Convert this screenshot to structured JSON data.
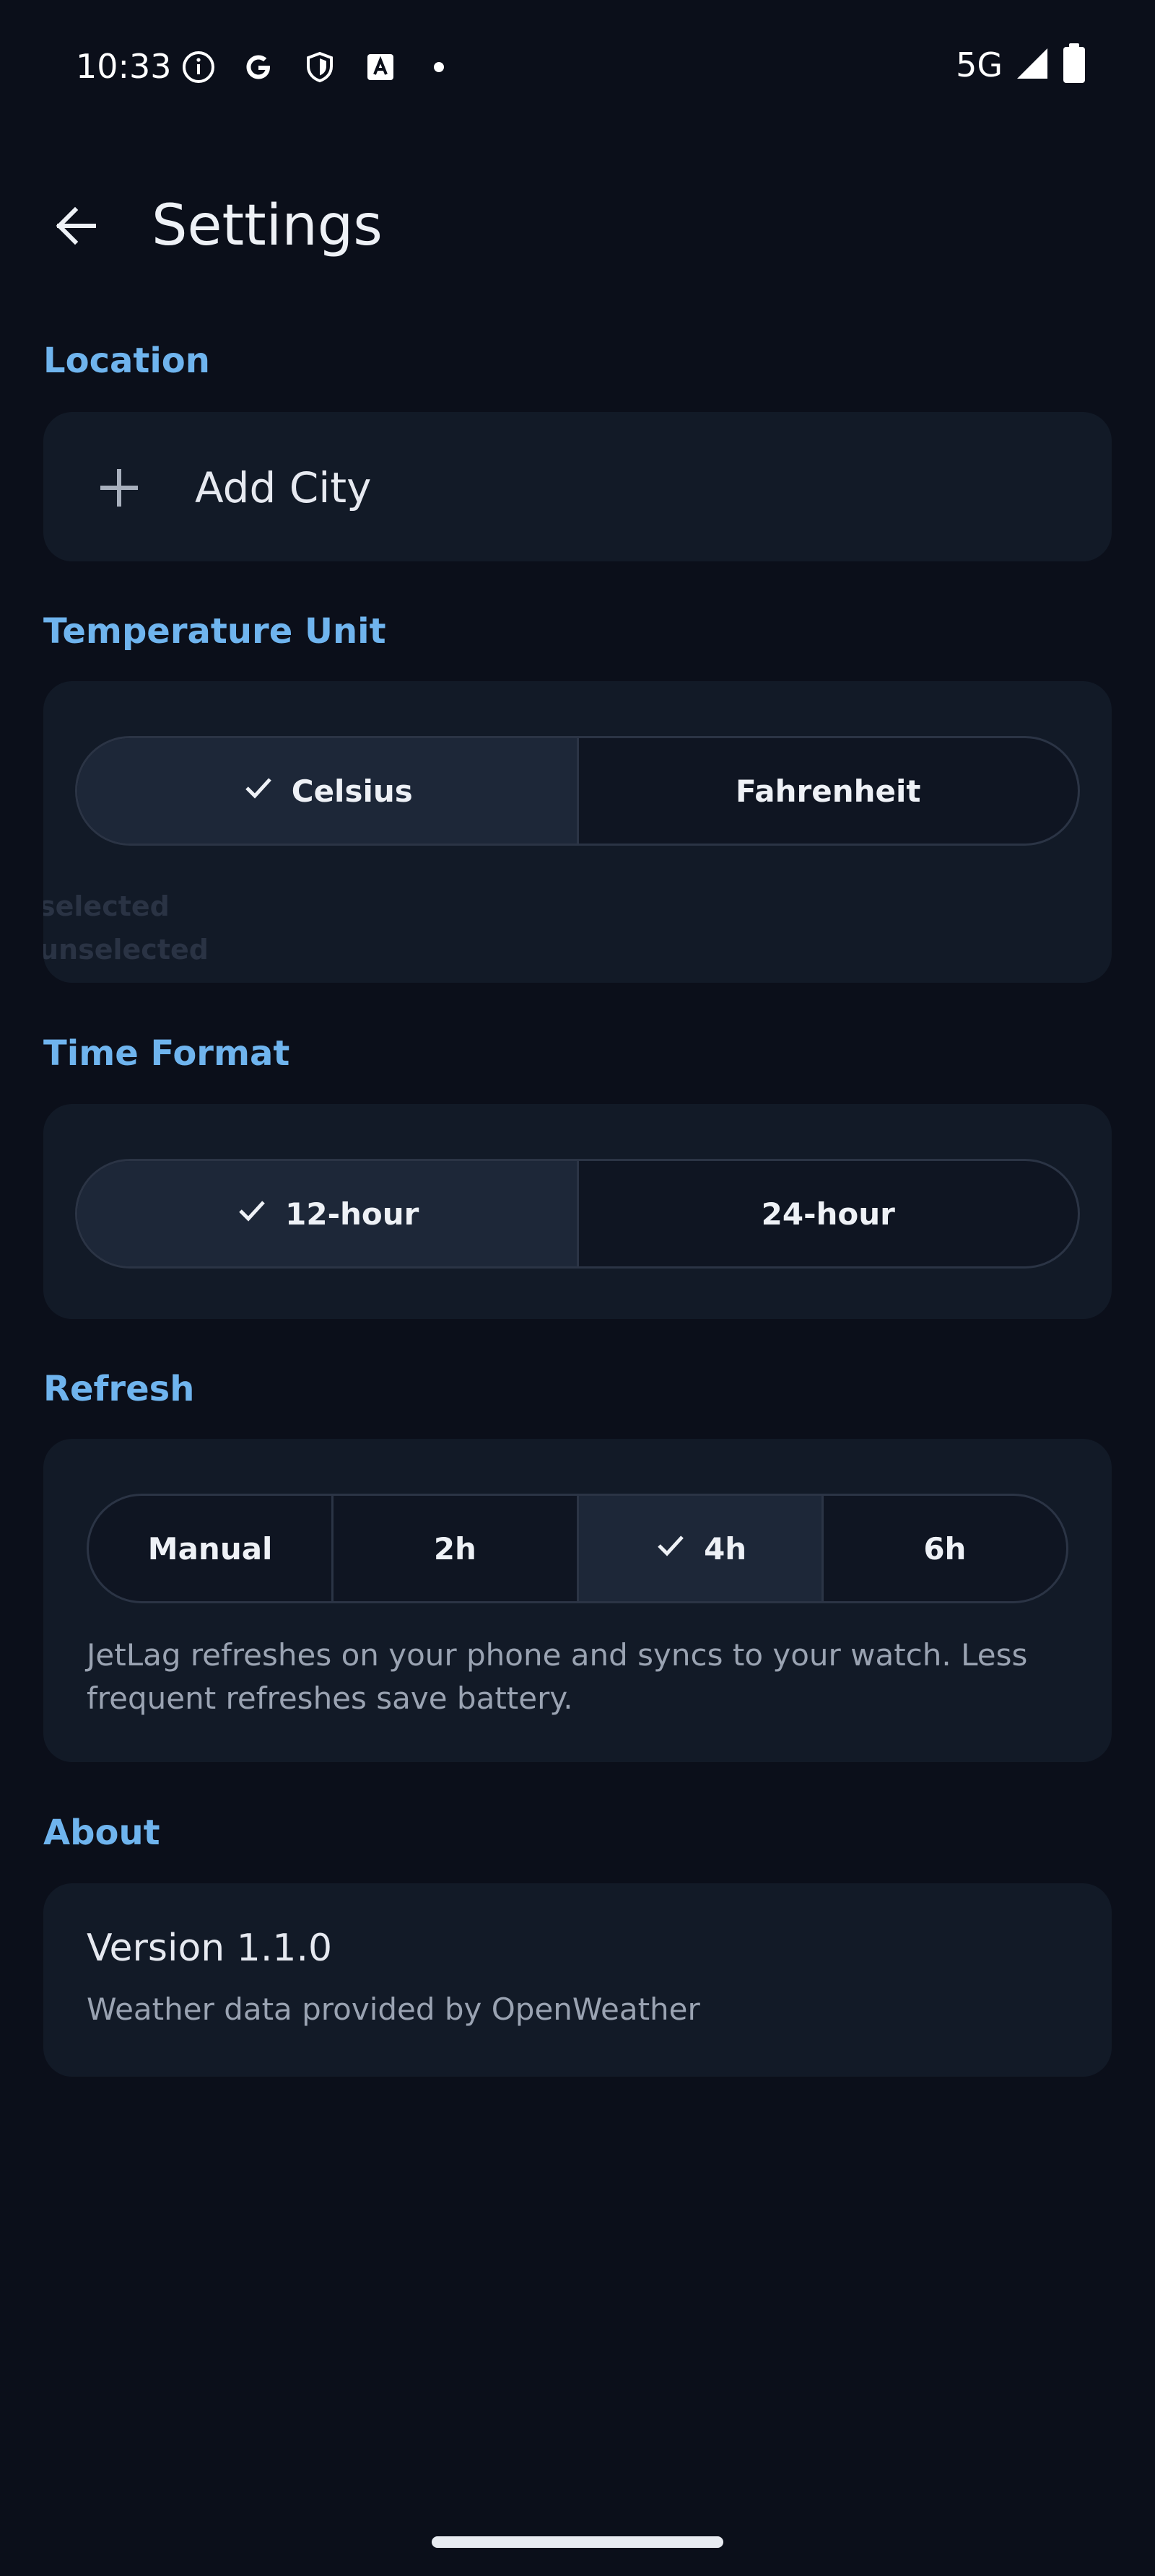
{
  "status_bar": {
    "time": "10:33",
    "network": "5G",
    "icons": [
      "info-icon",
      "google-icon",
      "shield-icon",
      "accessibility-icon",
      "dot-icon",
      "signal-icon",
      "battery-icon"
    ]
  },
  "header": {
    "title": "Settings",
    "back_icon": "back-arrow-icon"
  },
  "sections": {
    "location": {
      "label": "Location",
      "add_city_label": "Add City",
      "add_icon": "plus-icon"
    },
    "temperature": {
      "label": "Temperature Unit",
      "options": [
        "Celsius",
        "Fahrenheit"
      ],
      "selected": "Celsius",
      "ghost_selected": "selected",
      "ghost_unselected": "unselected"
    },
    "time_format": {
      "label": "Time Format",
      "options": [
        "12-hour",
        "24-hour"
      ],
      "selected": "12-hour"
    },
    "refresh": {
      "label": "Refresh",
      "options": [
        "Manual",
        "2h",
        "4h",
        "6h"
      ],
      "selected": "4h",
      "description": "JetLag refreshes on your phone and syncs to your watch. Less frequent refreshes save battery."
    },
    "about": {
      "label": "About",
      "version": "Version 1.1.0",
      "provided_by": "Weather data provided by OpenWeather"
    }
  },
  "colors": {
    "background": "#0b0f1a",
    "card": "#121a27",
    "accent": "#6fb4ee",
    "selected_segment": "#1d2738",
    "segment_border": "#2b3445"
  }
}
